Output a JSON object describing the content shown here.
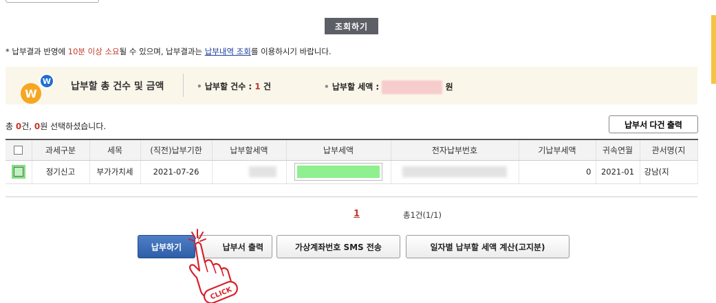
{
  "query": {
    "button_label": "조회하기"
  },
  "notice": {
    "prefix": "* 납부결과 반영에 ",
    "highlight": "10분 이상 소요",
    "middle": "될 수 있으며, 납부결과는 ",
    "link_text": "납부내역 조회",
    "suffix": "를 이용하시기 바랍니다."
  },
  "summary": {
    "title": "납부할 총 건수 및 금액",
    "count_label": "납부할 건수 : ",
    "count_value": "1",
    "count_unit": "건",
    "amount_label": "납부할 세액 : ",
    "amount_unit": "원"
  },
  "selection": {
    "prefix": "총 ",
    "count": "0",
    "middle": "건, ",
    "amount": "0",
    "suffix": "원 선택하셨습니다."
  },
  "multi_print_label": "납부서 다건 출력",
  "table": {
    "headers": [
      "과세구분",
      "세목",
      "(직전)납부기한",
      "납부할세액",
      "납부세액",
      "전자납부번호",
      "기납부세액",
      "귀속연월",
      "관서명(지"
    ],
    "row": {
      "tax_category": "정기신고",
      "tax_item": "부가가치세",
      "due_date": "2021-07-26",
      "prepaid": "0",
      "period": "2021-01",
      "office": "강남(지"
    }
  },
  "pagination": {
    "current": "1",
    "total_text": "총1건(1/1)"
  },
  "buttons": {
    "pay": "납부하기",
    "print": "납부서 출력",
    "sms": "가상계좌번호 SMS 전송",
    "calc": "일자별 납부할 세액 계산(고지분)"
  },
  "overlay": {
    "click_label": "CLICK"
  },
  "colors": {
    "accent_red": "#c0392b",
    "primary_blue": "#2f5ea8",
    "highlight_green": "#8ef08e"
  }
}
